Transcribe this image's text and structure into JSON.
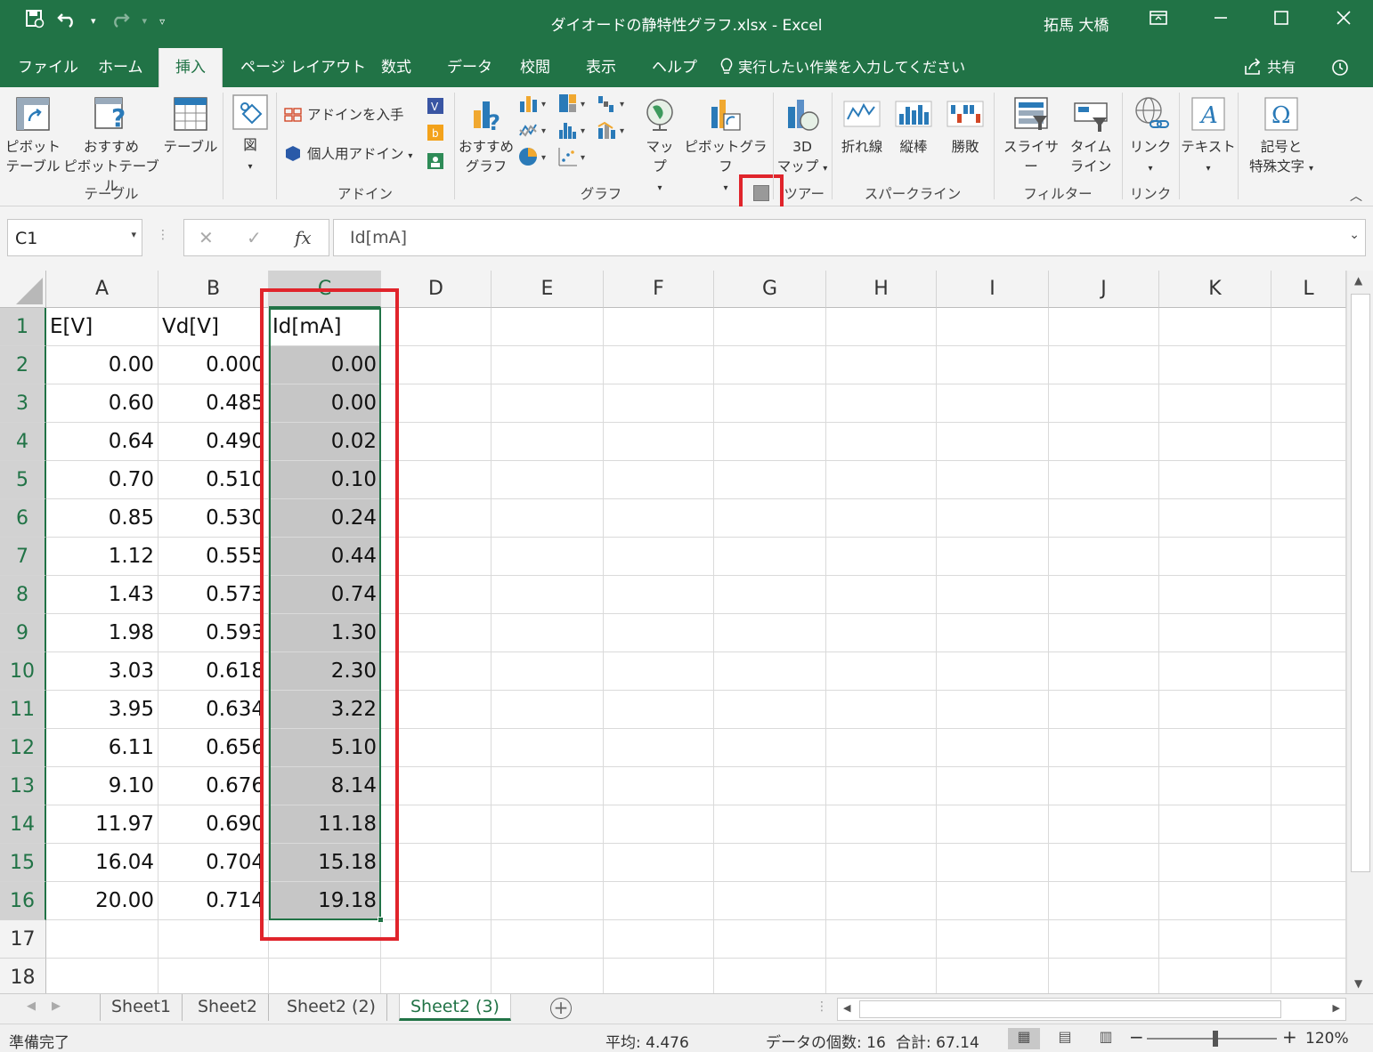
{
  "titlebar": {
    "doc_title": "ダイオードの静特性グラフ.xlsx  -  Excel",
    "user": "拓馬 大橋"
  },
  "tabs": [
    "ファイル",
    "ホーム",
    "挿入",
    "ページ レイアウト",
    "数式",
    "データ",
    "校閲",
    "表示",
    "ヘルプ"
  ],
  "active_tab": "挿入",
  "tell_me": "実行したい作業を入力してください",
  "share": "共有",
  "ribbon": {
    "pivot_table": [
      "ピボット",
      "テーブル"
    ],
    "recommended_pivot": [
      "おすすめ",
      "ピボットテーブル"
    ],
    "table": "テーブル",
    "illustrations": "図",
    "get_addins": "アドインを入手",
    "my_addins": "個人用アドイン",
    "recommended_charts": [
      "おすすめ",
      "グラフ"
    ],
    "maps": "マップ",
    "pivot_chart": "ピボットグラフ",
    "map3d": [
      "3D",
      "マップ"
    ],
    "line": "折れ線",
    "column": "縦棒",
    "winloss": "勝敗",
    "slicer": "スライサー",
    "timeline": [
      "タイム",
      "ライン"
    ],
    "link": "リンク",
    "text": "テキスト",
    "symbols": [
      "記号と",
      "特殊文字"
    ],
    "groups": {
      "tables": "テーブル",
      "addins": "アドイン",
      "charts": "グラフ",
      "tours": "ツアー",
      "sparklines": "スパークライン",
      "filters": "フィルター",
      "links": "リンク"
    }
  },
  "formula_bar": {
    "name_box": "C1",
    "fx": "fx",
    "content": "Id[mA]"
  },
  "columns": [
    "A",
    "B",
    "C",
    "D",
    "E",
    "F",
    "G",
    "H",
    "I",
    "J",
    "K",
    "L"
  ],
  "rows": [
    "1",
    "2",
    "3",
    "4",
    "5",
    "6",
    "7",
    "8",
    "9",
    "10",
    "11",
    "12",
    "13",
    "14",
    "15",
    "16",
    "17",
    "18"
  ],
  "sheet_cells": {
    "headers": [
      "E[V]",
      "Vd[V]",
      "Id[mA]"
    ],
    "A": [
      "0.00",
      "0.60",
      "0.64",
      "0.70",
      "0.85",
      "1.12",
      "1.43",
      "1.98",
      "3.03",
      "3.95",
      "6.11",
      "9.10",
      "11.97",
      "16.04",
      "20.00"
    ],
    "B": [
      "0.000",
      "0.485",
      "0.490",
      "0.510",
      "0.530",
      "0.555",
      "0.573",
      "0.593",
      "0.618",
      "0.634",
      "0.656",
      "0.676",
      "0.690",
      "0.704",
      "0.714"
    ],
    "C": [
      "0.00",
      "0.00",
      "0.02",
      "0.10",
      "0.24",
      "0.44",
      "0.74",
      "1.30",
      "2.30",
      "3.22",
      "5.10",
      "8.14",
      "11.18",
      "15.18",
      "19.18"
    ]
  },
  "sheets": [
    "Sheet1",
    "Sheet2",
    "Sheet2 (2)",
    "Sheet2 (3)"
  ],
  "active_sheet": "Sheet2 (3)",
  "status": {
    "ready": "準備完了",
    "average": "平均: 4.476",
    "count": "データの個数: 16",
    "sum": "合計: 67.14",
    "zoom": "120%"
  },
  "colors": {
    "excel_green": "#217346",
    "highlight_red": "#e0242b"
  }
}
